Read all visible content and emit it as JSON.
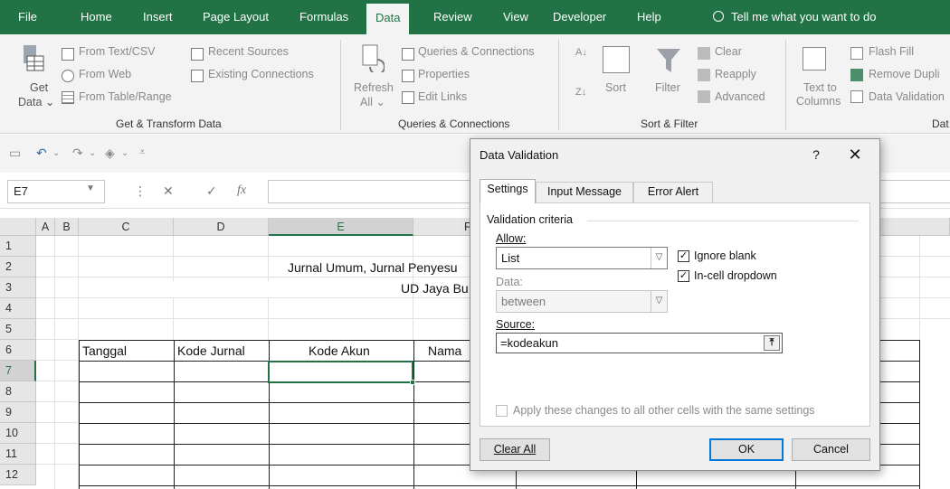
{
  "ribbon_tabs": {
    "file": "File",
    "home": "Home",
    "insert": "Insert",
    "page_layout": "Page Layout",
    "formulas": "Formulas",
    "data": "Data",
    "review": "Review",
    "view": "View",
    "developer": "Developer",
    "help": "Help",
    "tell_me": "Tell me what you want to do"
  },
  "ribbon": {
    "get_data_1": "Get",
    "get_data_2": "Data",
    "from_text_csv": "From Text/CSV",
    "from_web": "From Web",
    "from_table_range": "From Table/Range",
    "recent_sources": "Recent Sources",
    "existing_connections": "Existing Connections",
    "group_get_transform": "Get & Transform Data",
    "refresh_1": "Refresh",
    "refresh_2": "All",
    "queries_connections": "Queries & Connections",
    "properties": "Properties",
    "edit_links": "Edit Links",
    "group_queries": "Queries & Connections",
    "sort": "Sort",
    "filter": "Filter",
    "clear": "Clear",
    "reapply": "Reapply",
    "advanced": "Advanced",
    "group_sort_filter": "Sort & Filter",
    "text_to_1": "Text to",
    "text_to_2": "Columns",
    "flash_fill": "Flash Fill",
    "remove_duplicates": "Remove Dupli",
    "data_validation": "Data Validation",
    "group_data_tools": "Dat"
  },
  "formula_bar": {
    "name_box": "E7",
    "fx": "fx"
  },
  "grid": {
    "columns": [
      "A",
      "B",
      "C",
      "D",
      "E",
      "F"
    ],
    "rows": [
      "1",
      "2",
      "3",
      "4",
      "5",
      "6",
      "7",
      "8",
      "9",
      "10",
      "11",
      "12"
    ],
    "title1": "Jurnal Umum, Jurnal Penyesu",
    "title2": "UD Jaya Bu",
    "headers": {
      "tanggal": "Tanggal",
      "kode_jurnal": "Kode Jurnal",
      "kode_akun": "Kode Akun",
      "nama": "Nama"
    }
  },
  "dialog": {
    "title": "Data Validation",
    "help": "?",
    "close": "✕",
    "tabs": {
      "settings": "Settings",
      "input_message": "Input Message",
      "error_alert": "Error Alert"
    },
    "validation_criteria": "Validation criteria",
    "allow_label": "Allow:",
    "allow_value": "List",
    "ignore_blank": "Ignore blank",
    "in_cell_dropdown": "In-cell dropdown",
    "data_label": "Data:",
    "data_value": "between",
    "source_label": "Source:",
    "source_value": "=kodeakun",
    "apply_all": "Apply these changes to all other cells with the same settings",
    "clear_all": "Clear All",
    "ok": "OK",
    "cancel": "Cancel"
  }
}
